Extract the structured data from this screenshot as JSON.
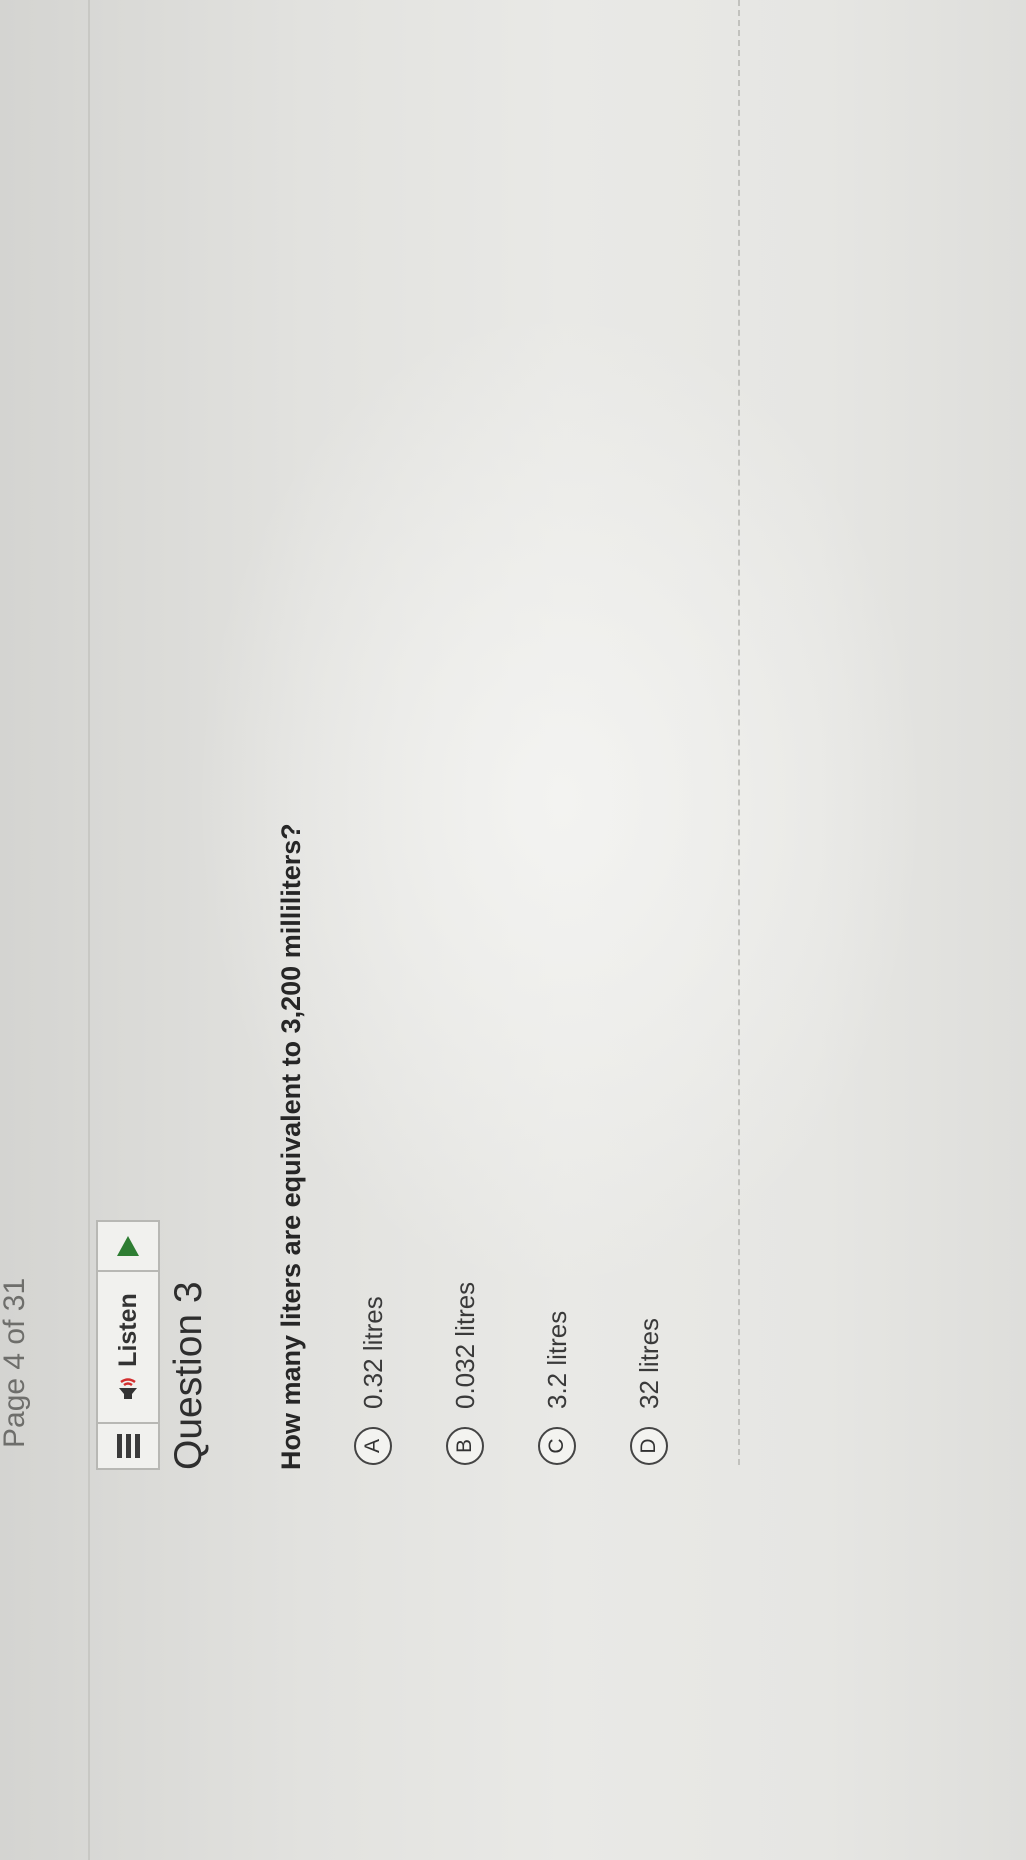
{
  "page_indicator": "Page 4 of 31",
  "toolbar": {
    "menu_icon": "menu-bars-icon",
    "listen_label": "Listen",
    "speaker_icon": "speaker-icon",
    "play_icon": "play-icon",
    "play_color": "#2e7d32"
  },
  "question": {
    "title": "Question 3",
    "text": "How many liters are equivalent to 3,200 milliliters?"
  },
  "choices": [
    {
      "letter": "A",
      "label": "0.32 litres"
    },
    {
      "letter": "B",
      "label": "0.032 litres"
    },
    {
      "letter": "C",
      "label": "3.2 litres"
    },
    {
      "letter": "D",
      "label": "32 litres"
    }
  ]
}
